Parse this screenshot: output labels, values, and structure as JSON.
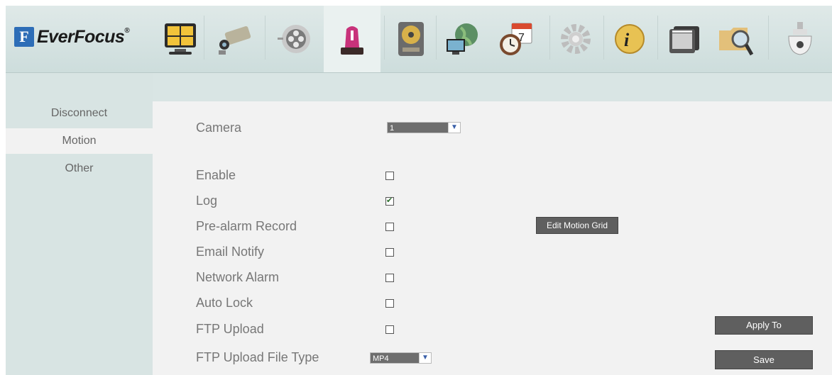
{
  "brand": {
    "name": "EverFocus",
    "mark": "F",
    "reg": "®"
  },
  "toolbar": {
    "items": [
      {
        "name": "live-view-icon"
      },
      {
        "name": "camera-icon"
      },
      {
        "name": "record-icon"
      },
      {
        "name": "alarm-icon",
        "active": true
      },
      {
        "name": "hdd-icon"
      },
      {
        "name": "network-icon"
      },
      {
        "name": "schedule-icon"
      },
      {
        "name": "settings-icon"
      },
      {
        "name": "info-icon"
      },
      {
        "name": "playback-icon"
      },
      {
        "name": "search-icon"
      },
      {
        "name": "ptz-icon"
      }
    ],
    "schedule_date": "7"
  },
  "sidebar": {
    "items": [
      {
        "label": "Disconnect",
        "active": false
      },
      {
        "label": "Motion",
        "active": true
      },
      {
        "label": "Other",
        "active": false
      }
    ]
  },
  "form": {
    "camera_label": "Camera",
    "camera_value": "1",
    "enable_label": "Enable",
    "enable_checked": false,
    "log_label": "Log",
    "log_checked": true,
    "pre_alarm_label": "Pre-alarm Record",
    "pre_alarm_checked": false,
    "email_label": "Email Notify",
    "email_checked": false,
    "network_alarm_label": "Network Alarm",
    "network_alarm_checked": false,
    "auto_lock_label": "Auto Lock",
    "auto_lock_checked": false,
    "ftp_upload_label": "FTP Upload",
    "ftp_upload_checked": false,
    "ftp_type_label": "FTP Upload File Type",
    "ftp_type_value": "MP4"
  },
  "buttons": {
    "edit_motion_grid": "Edit Motion Grid",
    "apply_to": "Apply To",
    "save": "Save"
  },
  "colors": {
    "accent": "#2d6db7",
    "header_bg": "#d4e2e1",
    "button_bg": "#5f5f5f"
  }
}
